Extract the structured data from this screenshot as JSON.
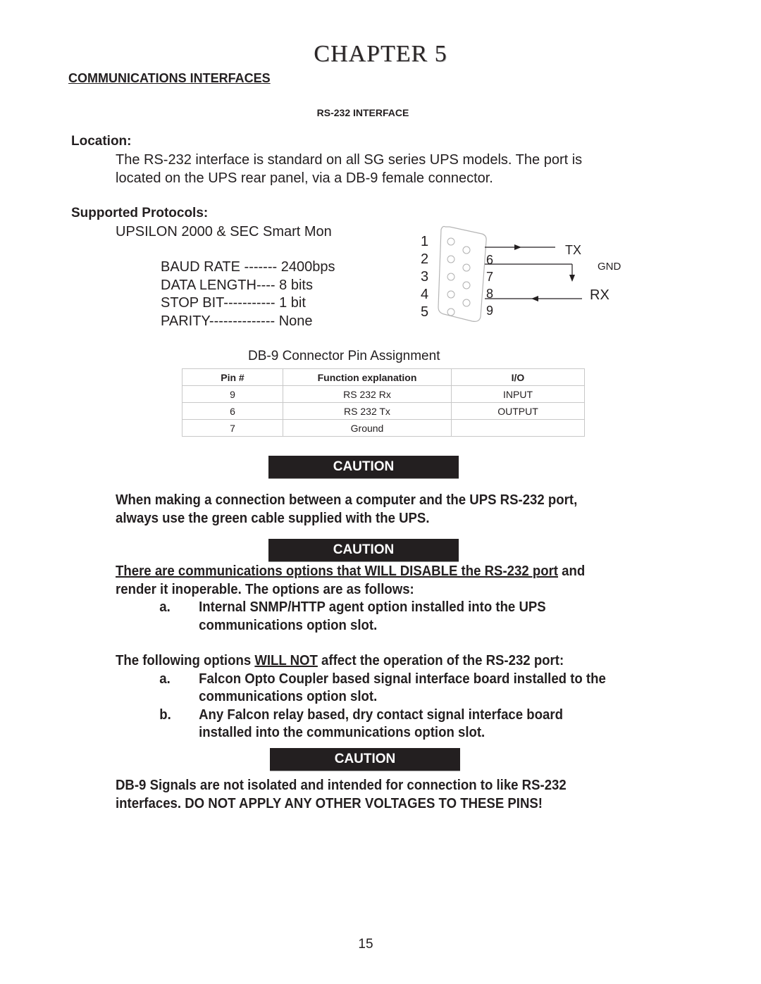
{
  "header": {
    "chapter": "CHAPTER 5",
    "section": "COMMUNICATIONS INTERFACES",
    "subsection": "RS-232 INTERFACE"
  },
  "location": {
    "heading": "Location:",
    "lines": [
      "The RS-232 interface is standard on all SG series UPS models. The port is",
      "located on the UPS rear panel, via a DB-9 female connector."
    ]
  },
  "protocols": {
    "heading": "Supported Protocols:",
    "name": "UPSILON 2000 & SEC Smart Mon",
    "params": [
      {
        "label": "BAUD RATE -------",
        "value": "2400bps"
      },
      {
        "label": "DATA LENGTH----",
        "value": "8 bits"
      },
      {
        "label": "STOP BIT-----------",
        "value": "1 bit"
      },
      {
        "label": "PARITY--------------",
        "value": "None"
      }
    ]
  },
  "diagram": {
    "left_pins": [
      "1",
      "2",
      "3",
      "4",
      "5"
    ],
    "right_pins": [
      "6",
      "7",
      "8",
      "9"
    ],
    "tx_label": "TX",
    "gnd_label": "GND",
    "rx_label": "RX",
    "caption": "DB-9 Connector Pin Assignment"
  },
  "pin_table": {
    "headers": [
      "Pin #",
      "Function explanation",
      "I/O"
    ],
    "rows": [
      [
        "9",
        "RS 232 Rx",
        "INPUT"
      ],
      [
        "6",
        "RS 232 Tx",
        "OUTPUT"
      ],
      [
        "7",
        "Ground",
        ""
      ]
    ]
  },
  "cautions": [
    {
      "label": "CAUTION",
      "text": [
        "When making a connection between a computer and the UPS RS-232 port,",
        "always use the green cable supplied with the UPS."
      ]
    },
    {
      "label": "CAUTION",
      "intro_underlined": "There are communications options that WILL DISABLE the RS-232 port",
      "intro_rest": " and",
      "intro_line2": "render it inoperable. The options are as follows:",
      "disable_items": [
        {
          "marker": "a.",
          "lines": [
            "Internal SNMP/HTTP agent option installed into the UPS",
            "communications option slot."
          ]
        }
      ],
      "notaffect_pre": "The following options ",
      "notaffect_underlined": "WILL NOT",
      "notaffect_post": " affect the operation of the RS-232 port:",
      "notaffect_items": [
        {
          "marker": "a.",
          "lines": [
            "Falcon Opto Coupler based signal interface board installed to the",
            "communications option slot."
          ]
        },
        {
          "marker": "b.",
          "lines": [
            "Any Falcon relay based, dry contact signal interface board",
            "installed into the communications option slot."
          ]
        }
      ]
    },
    {
      "label": "CAUTION",
      "text": [
        "DB-9 Signals are not isolated and intended for connection to like RS-232",
        "interfaces. DO NOT APPLY ANY OTHER VOLTAGES TO THESE PINS!"
      ]
    }
  ],
  "footer": {
    "page_number": "15"
  }
}
